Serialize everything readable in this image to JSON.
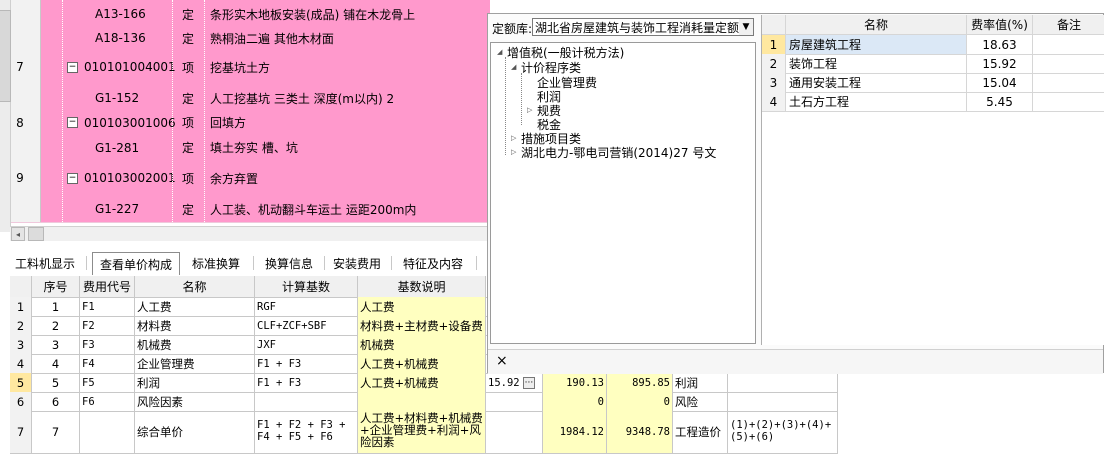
{
  "top_grid": {
    "rows": [
      {
        "no": "",
        "code": "A13-166",
        "type": "定",
        "name": "条形实木地板安装(成品) 铺在木龙骨上",
        "expandable": false
      },
      {
        "no": "",
        "code": "A18-136",
        "type": "定",
        "name": "熟桐油二遍 其他木材面",
        "expandable": false
      },
      {
        "no": "7",
        "code": "010101004001",
        "type": "项",
        "name": "挖基坑土方",
        "expandable": true
      },
      {
        "no": "",
        "code": "G1-152",
        "type": "定",
        "name": "人工挖基坑 三类土 深度(m以内) 2",
        "expandable": false
      },
      {
        "no": "8",
        "code": "010103001006",
        "type": "项",
        "name": "回填方",
        "expandable": true
      },
      {
        "no": "",
        "code": "G1-281",
        "type": "定",
        "name": "填土夯实 槽、坑",
        "expandable": false
      },
      {
        "no": "9",
        "code": "010103002001",
        "type": "项",
        "name": "余方弃置",
        "expandable": true
      },
      {
        "no": "",
        "code": "G1-227",
        "type": "定",
        "name": "人工装、机动翻斗车运土 运距200m内",
        "expandable": false
      }
    ]
  },
  "tabs": [
    {
      "label": "工料机显示",
      "active": false
    },
    {
      "label": "查看单价构成",
      "active": true
    },
    {
      "label": "标准换算",
      "active": false
    },
    {
      "label": "换算信息",
      "active": false
    },
    {
      "label": "安装费用",
      "active": false
    },
    {
      "label": "特征及内容",
      "active": false
    }
  ],
  "bottom_table": {
    "headers": [
      "序号",
      "费用代号",
      "名称",
      "计算基数",
      "基数说明"
    ],
    "rows": [
      {
        "idx": "1",
        "seq": "1",
        "code": "F1",
        "name": "人工费",
        "base": "RGF",
        "desc": "人工费",
        "rate": "",
        "unit_price": "",
        "amount": "",
        "fee_type": "",
        "remark": ""
      },
      {
        "idx": "2",
        "seq": "2",
        "code": "F2",
        "name": "材料费",
        "base": "CLF+ZCF+SBF",
        "desc": "材料费+主材费+设备费",
        "rate": "",
        "unit_price": "",
        "amount": "",
        "fee_type": "",
        "remark": ""
      },
      {
        "idx": "3",
        "seq": "3",
        "code": "F3",
        "name": "机械费",
        "base": "JXF",
        "desc": "机械费",
        "rate": "",
        "unit_price": "",
        "amount": "",
        "fee_type": "",
        "remark": ""
      },
      {
        "idx": "4",
        "seq": "4",
        "code": "F4",
        "name": "企业管理费",
        "base": "F1 + F3",
        "desc": "人工费+机械费",
        "rate": "",
        "unit_price": "",
        "amount": "",
        "fee_type": "",
        "remark": ""
      },
      {
        "idx": "5",
        "seq": "5",
        "code": "F5",
        "name": "利润",
        "base": "F1 + F3",
        "desc": "人工费+机械费",
        "rate": "15.92",
        "unit_price": "190.13",
        "amount": "895.85",
        "fee_type": "利润",
        "remark": ""
      },
      {
        "idx": "6",
        "seq": "6",
        "code": "F6",
        "name": "风险因素",
        "base": "",
        "desc": "",
        "rate": "",
        "unit_price": "0",
        "amount": "0",
        "fee_type": "风险",
        "remark": ""
      },
      {
        "idx": "7",
        "seq": "7",
        "code": "",
        "name": "综合单价",
        "base": "F1 + F2 + F3 + F4 + F5 + F6",
        "desc": "人工费+材料费+机械费+企业管理费+利润+风险因素",
        "rate": "",
        "unit_price": "1984.12",
        "amount": "9348.78",
        "fee_type": "工程造价",
        "remark": "(1)+(2)+(3)+(4)+(5)+(6)"
      }
    ],
    "ellipsis_label": "···"
  },
  "popup": {
    "quota_label": "定额库:",
    "quota_value": "湖北省房屋建筑与装饰工程消耗量定额",
    "tree": {
      "root": "增值税(一般计税方法)",
      "group": "计价程序类",
      "leaves": [
        "企业管理费",
        "利润",
        "规费",
        "税金"
      ],
      "other1": "措施项目类",
      "other2": "湖北电力-鄂电司营销(2014)27 号文"
    },
    "rate_table": {
      "headers": [
        "名称",
        "费率值(%)",
        "备注"
      ],
      "rows": [
        {
          "no": "1",
          "name": "房屋建筑工程",
          "rate": "18.63",
          "note": ""
        },
        {
          "no": "2",
          "name": "装饰工程",
          "rate": "15.92",
          "note": ""
        },
        {
          "no": "3",
          "name": "通用安装工程",
          "rate": "15.04",
          "note": ""
        },
        {
          "no": "4",
          "name": "土石方工程",
          "rate": "5.45",
          "note": ""
        }
      ]
    },
    "close_label": "×"
  },
  "colors": {
    "pink_row": "#ff99cc",
    "yellow_cell": "#ffffc0",
    "selected_row": "#dbe8f6"
  }
}
